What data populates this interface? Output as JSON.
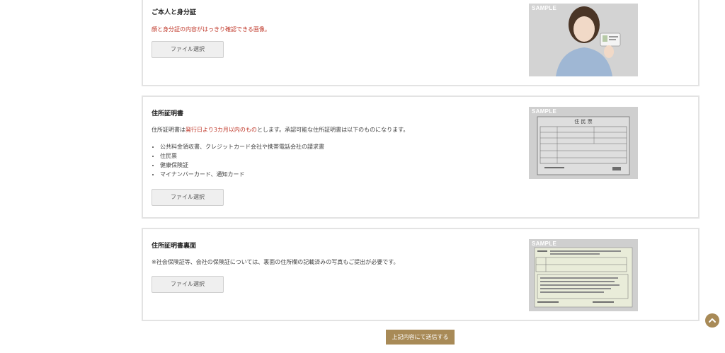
{
  "sections": [
    {
      "title": "ご本人と身分証",
      "note": "顔と身分証の内容がはっきり確認できる画像。",
      "button_label": "ファイル選択",
      "sample_label": "SAMPLE"
    },
    {
      "title": "住所証明書",
      "desc_pre": "住所証明書は",
      "desc_highlight": "発行日より3カ月以内のもの",
      "desc_post": "とします。承認可能な住所証明書は以下のものになります。",
      "items": [
        "公共料金領収書、クレジットカード会社や携帯電話会社の請求書",
        "住民票",
        "健康保険証",
        "マイナンバーカード、通知カード"
      ],
      "button_label": "ファイル選択",
      "sample_label": "SAMPLE",
      "sample_doc_title": "住 民 票"
    },
    {
      "title": "住所証明書裏面",
      "note": "※社会保険証等、会社の保険証については、裏面の住所欄の記載済みの写真もご提出が必要です。",
      "button_label": "ファイル選択",
      "sample_label": "SAMPLE"
    }
  ],
  "submit_label": "上記内容にて送信する",
  "colors": {
    "accent": "#a88a57",
    "highlight": "#c0392b",
    "border": "#e3e3e3"
  },
  "icons": {
    "back_to_top": "chevron-up-icon"
  }
}
